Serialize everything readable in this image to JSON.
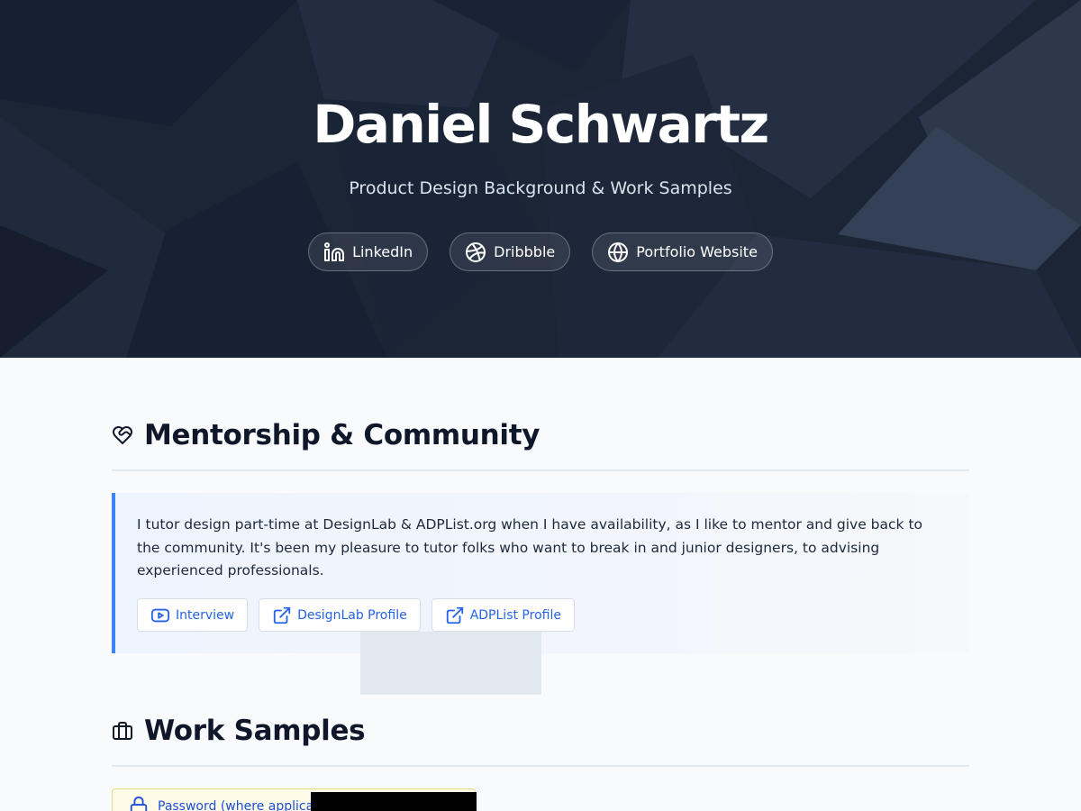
{
  "hero": {
    "name": "Daniel Schwartz",
    "subtitle": "Product Design Background & Work Samples",
    "links": [
      {
        "label": "LinkedIn",
        "icon": "linkedin-icon"
      },
      {
        "label": "Dribbble",
        "icon": "dribbble-icon"
      },
      {
        "label": "Portfolio Website",
        "icon": "globe-icon"
      }
    ]
  },
  "mentorship": {
    "icon": "heart-handshake-icon",
    "title": "Mentorship & Community",
    "body": "I tutor design part-time at DesignLab & ADPList.org when I have availability, as I like to mentor and give back to the community. It's been my pleasure to tutor folks who want to break in and junior designers, to advising experienced professionals.",
    "links": [
      {
        "label": "Interview",
        "icon": "youtube-icon"
      },
      {
        "label": "DesignLab Profile",
        "icon": "external-link-icon"
      },
      {
        "label": "ADPList Profile",
        "icon": "external-link-icon"
      }
    ]
  },
  "work_samples": {
    "icon": "briefcase-icon",
    "title": "Work Samples",
    "password_label": "Password (where applicable):"
  },
  "colors": {
    "hero_bg": "#1e293b",
    "accent": "#3b82f6",
    "link": "#2563eb",
    "page_bg": "#f8fafc"
  }
}
